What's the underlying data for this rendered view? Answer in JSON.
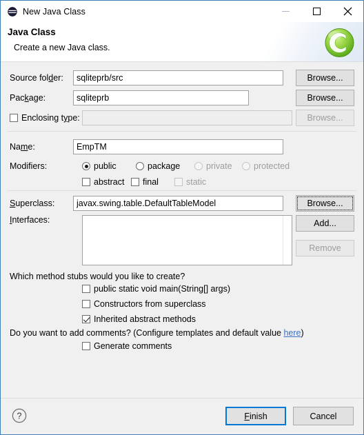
{
  "window": {
    "title": "New Java Class",
    "icon": "java-class-icon",
    "controls": {
      "minimize": "minimize-icon",
      "maximize": "maximize-icon",
      "close": "close-icon"
    }
  },
  "header": {
    "title": "Java Class",
    "subtitle": "Create a new Java class.",
    "logo": "eclipse-c-logo"
  },
  "form": {
    "source_folder": {
      "label": "Source folder:",
      "value": "sqliteprb/src",
      "button": "Browse..."
    },
    "package": {
      "label": "Package:",
      "value": "sqliteprb",
      "button": "Browse..."
    },
    "enclosing_type": {
      "label": "Enclosing type:",
      "checked": false,
      "value": "",
      "button": "Browse...",
      "disabled": true
    },
    "name": {
      "label": "Name:",
      "value": "EmpTM"
    },
    "modifiers": {
      "label": "Modifiers:",
      "radios": [
        {
          "label": "public",
          "selected": true,
          "disabled": false
        },
        {
          "label": "package",
          "selected": false,
          "disabled": false
        },
        {
          "label": "private",
          "selected": false,
          "disabled": true
        },
        {
          "label": "protected",
          "selected": false,
          "disabled": true
        }
      ],
      "checkboxes": [
        {
          "label": "abstract",
          "checked": false,
          "disabled": false
        },
        {
          "label": "final",
          "checked": false,
          "disabled": false
        },
        {
          "label": "static",
          "checked": false,
          "disabled": true
        }
      ]
    },
    "superclass": {
      "label": "Superclass:",
      "value": "javax.swing.table.DefaultTableModel",
      "button": "Browse..."
    },
    "interfaces": {
      "label": "Interfaces:",
      "items": [],
      "add_button": "Add...",
      "remove_button": "Remove",
      "remove_disabled": true
    }
  },
  "stubs": {
    "question": "Which method stubs would you like to create?",
    "options": [
      {
        "label": "public static void main(String[] args)",
        "checked": false
      },
      {
        "label": "Constructors from superclass",
        "checked": false
      },
      {
        "label": "Inherited abstract methods",
        "checked": true
      }
    ]
  },
  "comments": {
    "question_prefix": "Do you want to add comments? (Configure templates and default value ",
    "link": "here",
    "question_suffix": ")",
    "option": {
      "label": "Generate comments",
      "checked": false
    }
  },
  "footer": {
    "help": "help-icon",
    "finish": "Finish",
    "cancel": "Cancel"
  },
  "colors": {
    "accent": "#0078d7",
    "link": "#3b6fc4",
    "window_border": "#3f7fb5",
    "body_bg": "#f0f0f0",
    "logo_green": "#7ac943"
  }
}
